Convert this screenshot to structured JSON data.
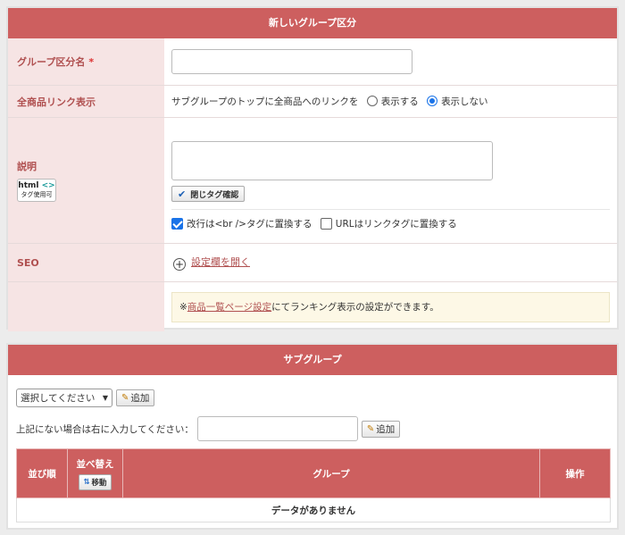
{
  "group_panel": {
    "title": "新しいグループ区分",
    "name_label": "グループ区分名",
    "required_mark": "*",
    "name_value": "",
    "link_label": "全商品リンク表示",
    "link_desc": "サブグループのトップに全商品へのリンクを",
    "radio_show": "表示する",
    "radio_hide": "表示しない",
    "selected_radio": "表示しない",
    "desc_label": "説明",
    "html_badge_top": "html",
    "html_badge_brackets": "<>",
    "html_badge_sub": "タグ使用可",
    "close_tag_button": "閉じタグ確認",
    "cb_br_label": "改行は<br />タグに置換する",
    "cb_url_label": "URLはリンクタグに置換する",
    "seo_label": "SEO",
    "seo_link": "設定欄を開く",
    "notice_prefix": "※",
    "notice_link": "商品一覧ページ設定",
    "notice_suffix": "にてランキング表示の設定ができます。"
  },
  "sub_panel": {
    "title": "サブグループ",
    "select_value": "選択してください",
    "add_label": "追加",
    "manual_label": "上記にない場合は右に入力してください：",
    "add_label2": "追加",
    "columns": {
      "order": "並び順",
      "sort": "並べ替え",
      "move": "移動",
      "group": "グループ",
      "action": "操作"
    },
    "empty_text": "データがありません"
  },
  "colors": {
    "header": "#cd5f5f",
    "label_bg": "#f6e4e4",
    "label_text": "#b05050",
    "notice_bg": "#fdf8e6",
    "accent_blue": "#1a73e8"
  }
}
